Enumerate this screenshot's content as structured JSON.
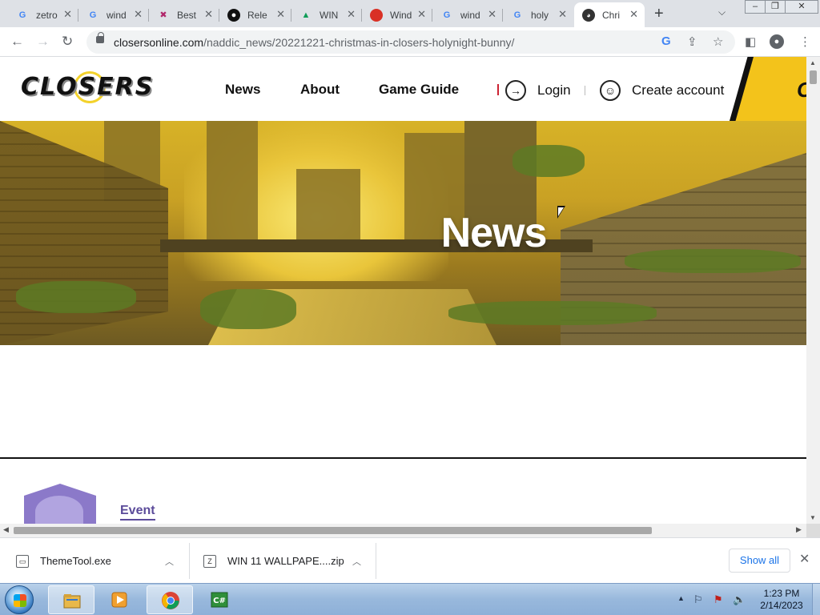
{
  "browser": {
    "tabs": [
      {
        "title": "zetro",
        "favicon": "google-icon",
        "color": "#4285f4"
      },
      {
        "title": "wind",
        "favicon": "google-icon",
        "color": "#4285f4"
      },
      {
        "title": "Best",
        "favicon": "x-logo-icon",
        "color": "#b0266a"
      },
      {
        "title": "Rele",
        "favicon": "github-icon",
        "color": "#111111"
      },
      {
        "title": "WIN",
        "favicon": "google-drive-icon",
        "color": "#0f9d58"
      },
      {
        "title": "Wind",
        "favicon": "round-red-badge-icon",
        "color": "#d93025"
      },
      {
        "title": "wind",
        "favicon": "google-icon",
        "color": "#4285f4"
      },
      {
        "title": "holy",
        "favicon": "google-icon",
        "color": "#4285f4"
      },
      {
        "title": "Chri",
        "favicon": "closers-face-icon",
        "color": "#333333",
        "active": true
      }
    ],
    "url_host": "closersonline.com",
    "url_path": "/naddic_news/20221221-christmas-in-closers-holynight-bunny/"
  },
  "site": {
    "logo_text": "CLOSERS",
    "nav": [
      "News",
      "About",
      "Game Guide"
    ],
    "login_label": "Login",
    "create_account_label": "Create account",
    "banner_letter": "C",
    "hero_title": "News",
    "event_label": "Event",
    "accent_yellow": "#f3c31b",
    "event_color": "#5b4b9a"
  },
  "downloads": {
    "items": [
      "ThemeTool.exe",
      "WIN 11 WALLPAPE....zip"
    ],
    "show_all_label": "Show all"
  },
  "taskbar": {
    "time": "1:23 PM",
    "date": "2/14/2023",
    "pinned": [
      "explorer-icon",
      "media-player-icon",
      "chrome-icon",
      "csharp-icon"
    ]
  }
}
